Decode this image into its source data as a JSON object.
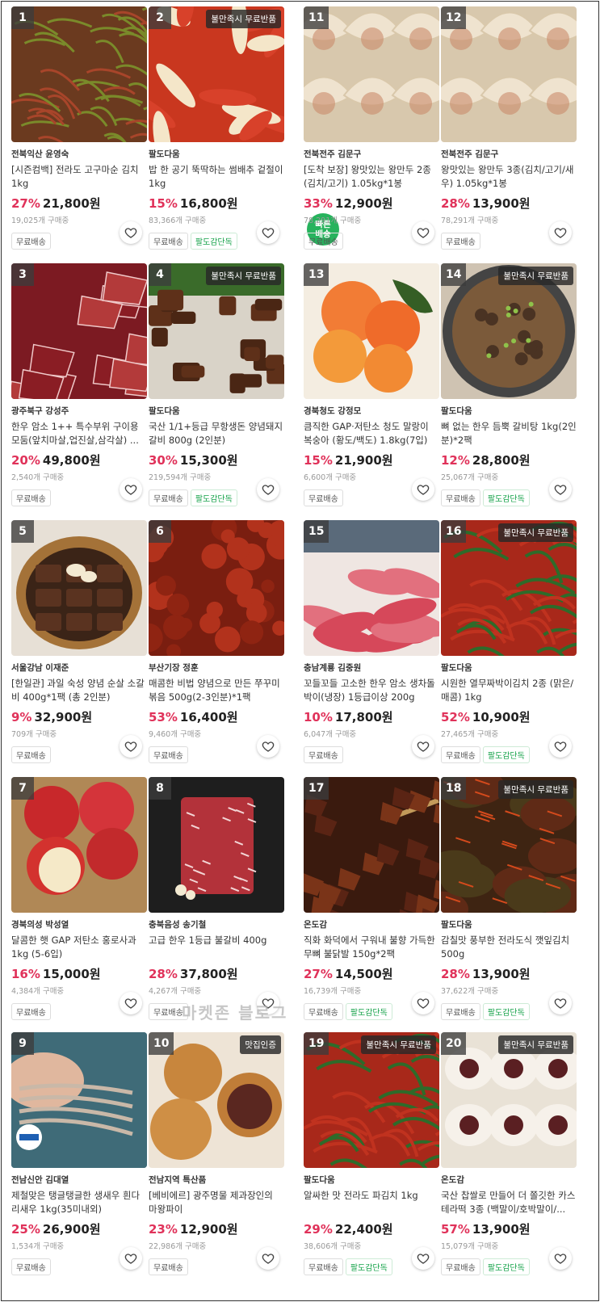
{
  "watermark": "마켓존 블로그",
  "products": [
    {
      "rank": "1",
      "seller": "전북익산 윤영숙",
      "title": "[시즌컴백] 전라도 고구마순 김치 1kg",
      "discount": "27%",
      "price": "21,800원",
      "buyers": "19,025개 구매중",
      "badges": [
        "무료배송"
      ],
      "tag": "",
      "img": "greens"
    },
    {
      "rank": "2",
      "seller": "팔도다움",
      "title": "밥 한 공기 뚝딱하는 썸배추 겉절이 1kg",
      "discount": "15%",
      "price": "16,800원",
      "buyers": "83,366개 구매중",
      "badges": [
        "무료배송",
        "팔도감단독"
      ],
      "tag": "불만족시 무료반품",
      "img": "kimchi"
    },
    {
      "rank": "3",
      "seller": "광주북구 강성주",
      "title": "한우 암소 1++ 특수부위 구이용 모둠(앞치마살,업진살,삼각살) ...",
      "discount": "20%",
      "price": "49,800원",
      "buyers": "2,540개 구매중",
      "badges": [
        "무료배송"
      ],
      "tag": "",
      "img": "rawbeef"
    },
    {
      "rank": "4",
      "seller": "팔도다움",
      "title": "국산 1/1+등급 무항생돈 양념돼지갈비 800g (2인분)",
      "discount": "30%",
      "price": "15,300원",
      "buyers": "219,594개 구매중",
      "badges": [
        "무료배송",
        "팔도감단독"
      ],
      "tag": "불만족시 무료반품",
      "img": "grilled"
    },
    {
      "rank": "5",
      "seller": "서울강남 이재준",
      "title": "[한일관] 과일 숙성 양념 순살 소갈비 400g*1팩 (총 2인분)",
      "discount": "9%",
      "price": "32,900원",
      "buyers": "709개 구매중",
      "badges": [
        "무료배송"
      ],
      "tag": "",
      "img": "bulgogi"
    },
    {
      "rank": "6",
      "seller": "부산기장 정훈",
      "title": "매콤한 비법 양념으로 만든 쭈꾸미 볶음 500g(2-3인분)*1팩",
      "discount": "53%",
      "price": "16,400원",
      "buyers": "9,460개 구매중",
      "badges": [
        "무료배송"
      ],
      "tag": "",
      "img": "octopus"
    },
    {
      "rank": "7",
      "seller": "경북의성 박성열",
      "title": "달콤한 햇 GAP 저탄소 홍로사과 1kg  (5-6입)",
      "discount": "16%",
      "price": "15,000원",
      "buyers": "4,384개 구매중",
      "badges": [
        "무료배송"
      ],
      "tag": "",
      "img": "apple"
    },
    {
      "rank": "8",
      "seller": "충북음성 송기철",
      "title": "고급 한우 1등급 불갈비 400g",
      "discount": "28%",
      "price": "37,800원",
      "buyers": "4,267개 구매중",
      "badges": [
        "무료배송"
      ],
      "tag": "",
      "img": "steak"
    },
    {
      "rank": "9",
      "seller": "전남신안 김대열",
      "title": "제철맞은 탱글탱글한  생새우 흰다리새우 1kg(35미내외)",
      "discount": "25%",
      "price": "26,900원",
      "buyers": "1,534개 구매중",
      "badges": [
        "무료배송"
      ],
      "tag": "",
      "img": "shrimp"
    },
    {
      "rank": "10",
      "seller": "전남지역 특산품",
      "title": "[베비에르] 광주명물 제과장인의 마왕파이",
      "discount": "23%",
      "price": "12,900원",
      "buyers": "22,986개 구매중",
      "badges": [
        "무료배송"
      ],
      "tag": "맛집인증",
      "img": "bread"
    },
    {
      "rank": "11",
      "seller": "전북전주 김문구",
      "title": "[도착 보장] 왕맛있는 왕만두 2종 (김치/고기) 1.05kg*1봉",
      "discount": "33%",
      "price": "12,900원",
      "buyers": "78,291개 구매중",
      "badges": [
        "무료배송"
      ],
      "tag": "",
      "img": "dumpling",
      "fastship": "빠른\n배송"
    },
    {
      "rank": "12",
      "seller": "전북전주 김문구",
      "title": "왕맛있는 왕만두 3종(김치/고기/새우) 1.05kg*1봉",
      "discount": "28%",
      "price": "13,900원",
      "buyers": "78,291개 구매중",
      "badges": [
        "무료배송"
      ],
      "tag": "",
      "img": "dumpling"
    },
    {
      "rank": "13",
      "seller": "경북청도 강정모",
      "title": "큼직한 GAP·저탄소 청도 말랑이 복숭아 (황도/백도) 1.8kg(7입)",
      "discount": "15%",
      "price": "21,900원",
      "buyers": "6,600개 구매중",
      "badges": [
        "무료배송"
      ],
      "tag": "",
      "img": "peach"
    },
    {
      "rank": "14",
      "seller": "팔도다움",
      "title": " 뼈 없는 한우 듬뿍 갈비탕 1kg(2인분)*2팩",
      "discount": "12%",
      "price": "28,800원",
      "buyers": "25,067개 구매중",
      "badges": [
        "무료배송",
        "팔도감단독"
      ],
      "tag": "불만족시 무료반품",
      "img": "soup"
    },
    {
      "rank": "15",
      "seller": "충남계룡 김중원",
      "title": "꼬들꼬들 고소한 한우 암소  생차돌박이(냉장) 1등급이상 200g",
      "discount": "10%",
      "price": "17,800원",
      "buyers": "6,047개 구매중",
      "badges": [
        "무료배송"
      ],
      "tag": "",
      "img": "brisket"
    },
    {
      "rank": "16",
      "seller": "팔도다움",
      "title": "시원한 열무짜박이김치 2종 (맑은/매콤) 1kg",
      "discount": "52%",
      "price": "10,900원",
      "buyers": "27,465개 구매중",
      "badges": [
        "무료배송",
        "팔도감단독"
      ],
      "tag": "불만족시 무료반품",
      "img": "yeolmu"
    },
    {
      "rank": "17",
      "seller": "온도감",
      "title": "직화 화덕에서 구워내 불향 가득한 무뼈 불닭발 150g*2팩",
      "discount": "27%",
      "price": "14,500원",
      "buyers": "16,739개 구매중",
      "badges": [
        "무료배송",
        "팔도감단독"
      ],
      "tag": "",
      "img": "chickenfeet"
    },
    {
      "rank": "18",
      "seller": "팔도다움",
      "title": "감칠맛 풍부한 전라도식 깻잎김치 500g",
      "discount": "28%",
      "price": "13,900원",
      "buyers": "37,622개 구매중",
      "badges": [
        "무료배송",
        "팔도감단독"
      ],
      "tag": "불만족시 무료반품",
      "img": "perilla"
    },
    {
      "rank": "19",
      "seller": "팔도다움",
      "title": "알싸한 맛 전라도 파김치 1kg",
      "discount": "29%",
      "price": "22,400원",
      "buyers": "38,606개 구매중",
      "badges": [
        "무료배송",
        "팔도감단독"
      ],
      "tag": "불만족시 무료반품",
      "img": "greenonion"
    },
    {
      "rank": "20",
      "seller": "온도감",
      "title": "국산 찹쌀로 만들어 더 쫄깃한 카스테라떡 3종 (백말이/호박말이/...",
      "discount": "57%",
      "price": "13,900원",
      "buyers": "15,079개 구매중",
      "badges": [
        "무료배송",
        "팔도감단독"
      ],
      "tag": "불만족시 무료반품",
      "img": "ricecake"
    }
  ],
  "colors": {
    "discount": "#e0325a",
    "badge_green": "#16a34a",
    "rank_bg": "#3c3c3c"
  }
}
